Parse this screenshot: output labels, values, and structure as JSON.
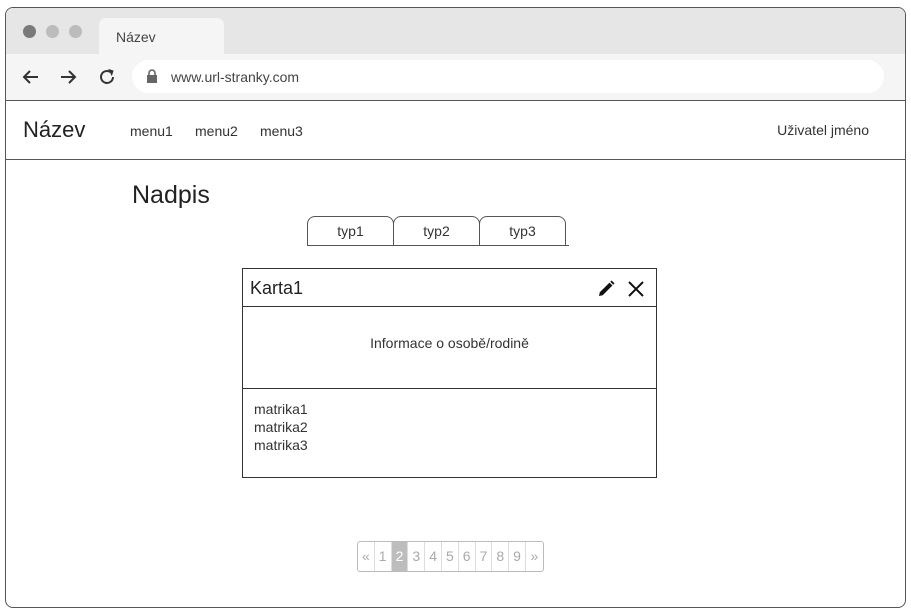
{
  "browser": {
    "tab_title": "Název",
    "url": "www.url-stranky.com"
  },
  "header": {
    "brand": "Název",
    "menu": [
      {
        "label": "menu1"
      },
      {
        "label": "menu2"
      },
      {
        "label": "menu3"
      }
    ],
    "username": "Uživatel jméno"
  },
  "main": {
    "heading": "Nadpis",
    "tabs": [
      {
        "label": "typ1"
      },
      {
        "label": "typ2"
      },
      {
        "label": "typ3"
      }
    ],
    "card": {
      "title": "Karta1",
      "info": "Informace o osobě/rodině",
      "items": [
        {
          "label": "matrika1"
        },
        {
          "label": "matrika2"
        },
        {
          "label": "matrika3"
        }
      ]
    },
    "pagination": {
      "prev": "«",
      "pages": [
        "1",
        "2",
        "3",
        "4",
        "5",
        "6",
        "7",
        "8",
        "9"
      ],
      "active_page": "2",
      "next": "»"
    }
  },
  "icons": {
    "back": "arrow-left-icon",
    "forward": "arrow-right-icon",
    "reload": "reload-icon",
    "lock": "lock-icon",
    "edit": "pencil-icon",
    "close": "close-icon"
  }
}
